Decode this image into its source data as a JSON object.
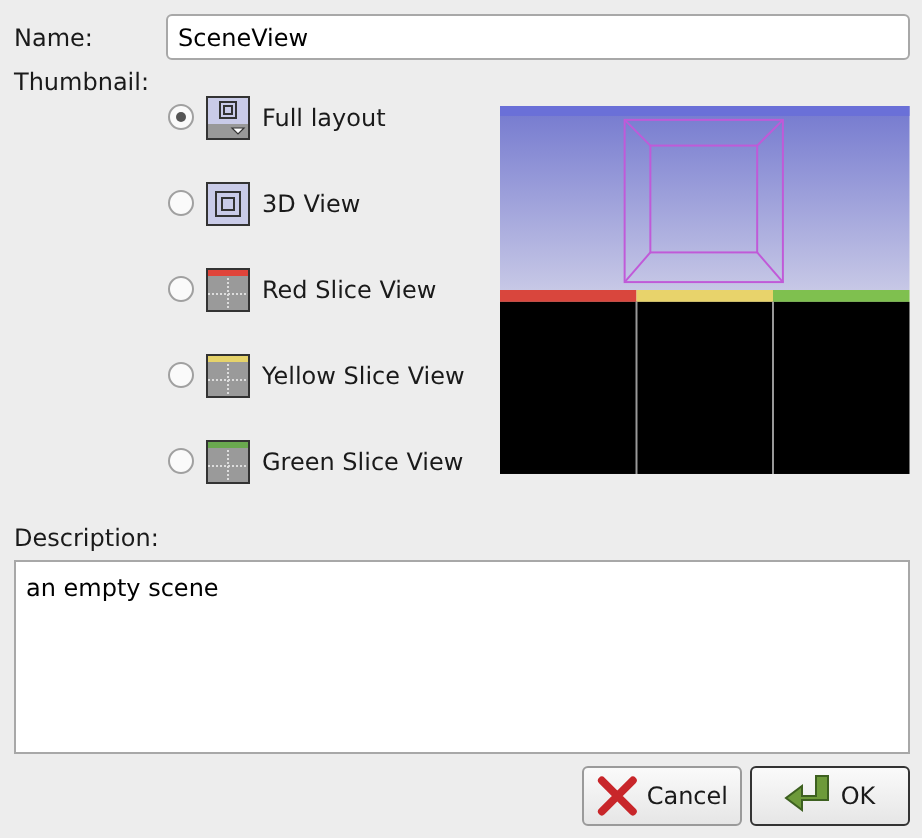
{
  "name_field": {
    "label": "Name:",
    "value": "SceneView"
  },
  "thumbnail": {
    "label": "Thumbnail:",
    "options": [
      {
        "label": "Full layout",
        "kind": "full",
        "selected": true
      },
      {
        "label": "3D View",
        "kind": "threed",
        "selected": false
      },
      {
        "label": "Red Slice View",
        "kind": "slice",
        "color": "#e0443a",
        "selected": false
      },
      {
        "label": "Yellow Slice View",
        "kind": "slice",
        "color": "#e6d36a",
        "selected": false
      },
      {
        "label": "Green Slice View",
        "kind": "slice",
        "color": "#6aa84f",
        "selected": false
      }
    ]
  },
  "description": {
    "label": "Description:",
    "value": "an empty scene"
  },
  "buttons": [
    {
      "label": "Cancel",
      "kind": "cancel"
    },
    {
      "label": "OK",
      "kind": "ok"
    }
  ]
}
